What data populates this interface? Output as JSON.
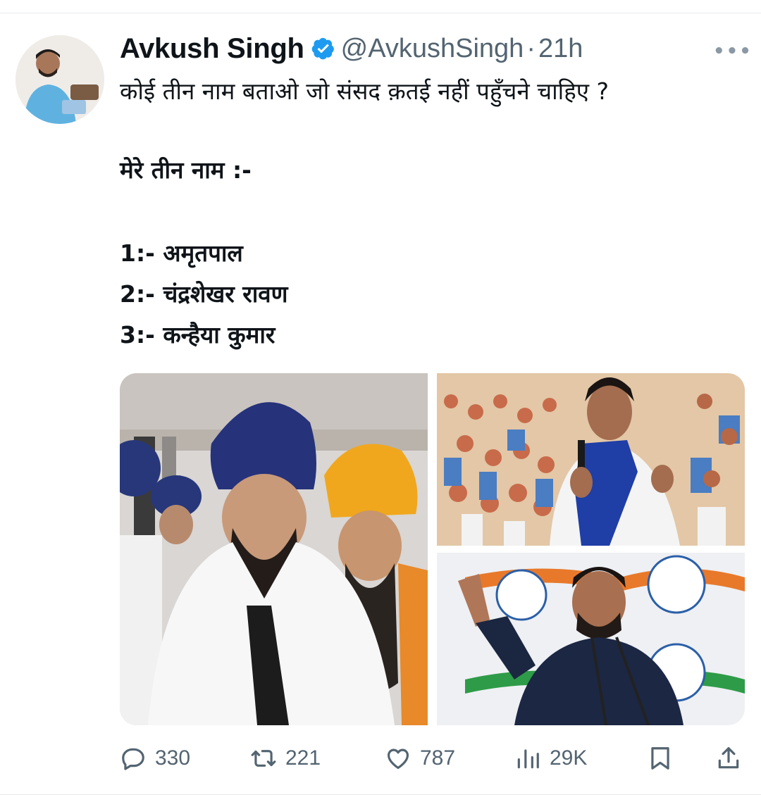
{
  "tweet": {
    "author": {
      "display_name": "Avkush Singh",
      "handle": "@AvkushSingh",
      "verified": true,
      "verified_color": "#1d9bf0"
    },
    "separator": "·",
    "time": "21h",
    "more_icon": "more-horizontal-icon",
    "text_lines": [
      "कोई तीन नाम बताओ जो संसद क़तई नहीं पहुँचने चाहिए ?",
      "मेरे तीन नाम :-",
      "1:- अमृतपाल",
      "2:- चंद्रशेखर रावण",
      "3:- कन्हैया कुमार"
    ],
    "media": [
      {
        "id": "photo-1",
        "subject": "man in navy turban with white shawl"
      },
      {
        "id": "photo-2",
        "subject": "man with microphone and blue scarf before crowd"
      },
      {
        "id": "photo-3",
        "subject": "man speaking at podium with raised hand"
      }
    ],
    "actions": {
      "replies": "330",
      "retweets": "221",
      "likes": "787",
      "views": "29K"
    }
  },
  "colors": {
    "text_primary": "#0f1419",
    "text_secondary": "#536471",
    "accent": "#1d9bf0"
  }
}
